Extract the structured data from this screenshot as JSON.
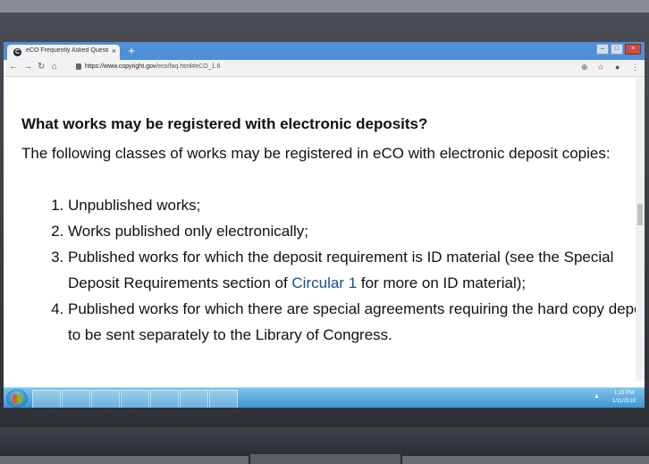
{
  "browser": {
    "tab_title": "eCO Frequently Asked Questions",
    "tab_close": "×",
    "new_tab": "+",
    "favicon": "C",
    "url_scheme": "https://www.copyright.gov",
    "url_path": "/eco/faq.html#eCO_1.6"
  },
  "page": {
    "heading": "What works may be registered with electronic deposits?",
    "intro": "The following classes of works may be registered in eCO with electronic deposit copies:",
    "items": [
      {
        "text": "Unpublished works;"
      },
      {
        "text": "Works published only electronically;"
      },
      {
        "before": "Published works for which the deposit requirement is ID material (see the Special Deposit Requirements section of ",
        "link": "Circular 1",
        "after": " for more on ID material);"
      },
      {
        "text": "Published works for which there are special agreements requiring the hard copy deposits to be sent separately to the Library of Congress."
      }
    ]
  },
  "taskbar": {
    "time": "1:23 PM",
    "date": "1/11/2019",
    "tray_arrow": "▲"
  },
  "colors": {
    "link": "#1a4f8f",
    "tab_bar": "#4f8fd8",
    "taskbar": "#3b93cf"
  }
}
